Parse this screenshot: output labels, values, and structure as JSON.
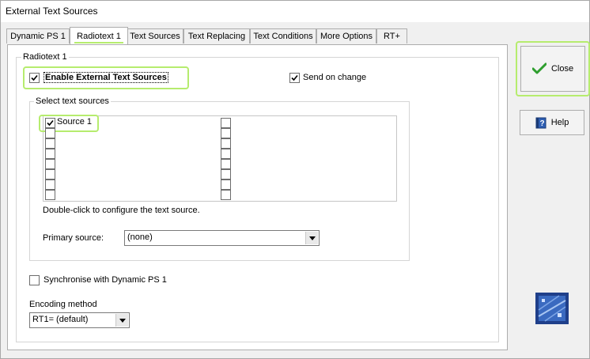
{
  "window": {
    "title": "External Text Sources"
  },
  "tabs": [
    {
      "label": "Dynamic PS 1"
    },
    {
      "label": "Radiotext 1"
    },
    {
      "label": "Text Sources"
    },
    {
      "label": "Text Replacing"
    },
    {
      "label": "Text Conditions"
    },
    {
      "label": "More Options"
    },
    {
      "label": "RT+"
    }
  ],
  "active_tab": "Radiotext 1",
  "panel": {
    "group_title": "Radiotext 1",
    "enable_external": {
      "label": "Enable External Text Sources",
      "checked": true
    },
    "send_on_change": {
      "label": "Send on change",
      "checked": true
    },
    "select_sources": {
      "title": "Select text sources",
      "left_column": [
        {
          "label": "Source 1",
          "checked": true
        },
        {
          "label": "",
          "checked": false
        },
        {
          "label": "",
          "checked": false
        },
        {
          "label": "",
          "checked": false
        },
        {
          "label": "",
          "checked": false
        },
        {
          "label": "",
          "checked": false
        },
        {
          "label": "",
          "checked": false
        },
        {
          "label": "",
          "checked": false
        }
      ],
      "right_column": [
        {
          "label": "",
          "checked": false
        },
        {
          "label": "",
          "checked": false
        },
        {
          "label": "",
          "checked": false
        },
        {
          "label": "",
          "checked": false
        },
        {
          "label": "",
          "checked": false
        },
        {
          "label": "",
          "checked": false
        },
        {
          "label": "",
          "checked": false
        },
        {
          "label": "",
          "checked": false
        }
      ],
      "hint": "Double-click to configure the text source.",
      "primary_source_label": "Primary source:",
      "primary_source_value": "(none)"
    },
    "synchronise": {
      "label": "Synchronise with Dynamic PS 1",
      "checked": false
    },
    "encoding": {
      "label": "Encoding method",
      "value": "RT1= (default)"
    }
  },
  "buttons": {
    "close": {
      "label": "Close",
      "icon": "checkmark-icon"
    },
    "help": {
      "label": "Help",
      "icon": "help-book-icon"
    }
  },
  "colors": {
    "highlight": "#b6ec6e",
    "check_green": "#2e9e2e"
  }
}
